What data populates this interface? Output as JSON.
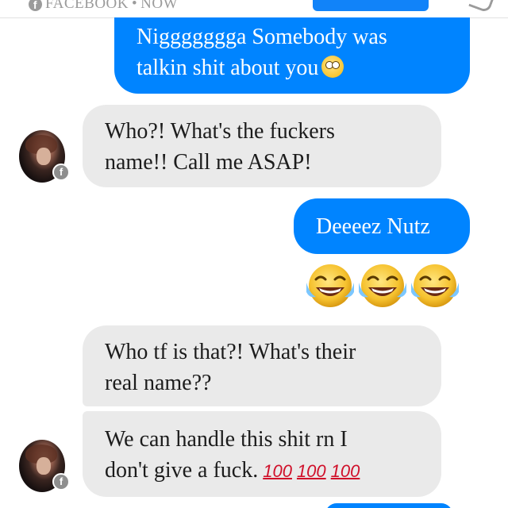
{
  "header": {
    "source_label": "FACEBOOK",
    "separator": "•",
    "time_label": "NOW",
    "fb_glyph": "f"
  },
  "messages": [
    {
      "direction": "outgoing",
      "lines": [
        "Niggggggga Somebody was",
        "talkin shit about you"
      ],
      "trailing_emoji": "flushed-face"
    },
    {
      "direction": "incoming",
      "lines": [
        "Who?! What's the fuckers",
        "name!! Call me ASAP!"
      ]
    },
    {
      "direction": "outgoing",
      "lines": [
        "Deeeez Nutz"
      ]
    },
    {
      "direction": "outgoing",
      "emoji_only": [
        "face-with-tears-of-joy",
        "face-with-tears-of-joy",
        "face-with-tears-of-joy"
      ]
    },
    {
      "direction": "incoming",
      "lines": [
        "Who tf is that?! What's their",
        "real name??"
      ]
    },
    {
      "direction": "incoming",
      "lines": [
        "We can handle this shit rn I",
        "don't give a fuck."
      ],
      "trailing_emoji_text": [
        "100",
        "100",
        "100"
      ]
    }
  ],
  "colors": {
    "outgoing_bubble": "#0084ff",
    "incoming_bubble": "#eaeaea",
    "hundred_red": "#d0102a",
    "meta_gray": "#9b9b9b"
  }
}
